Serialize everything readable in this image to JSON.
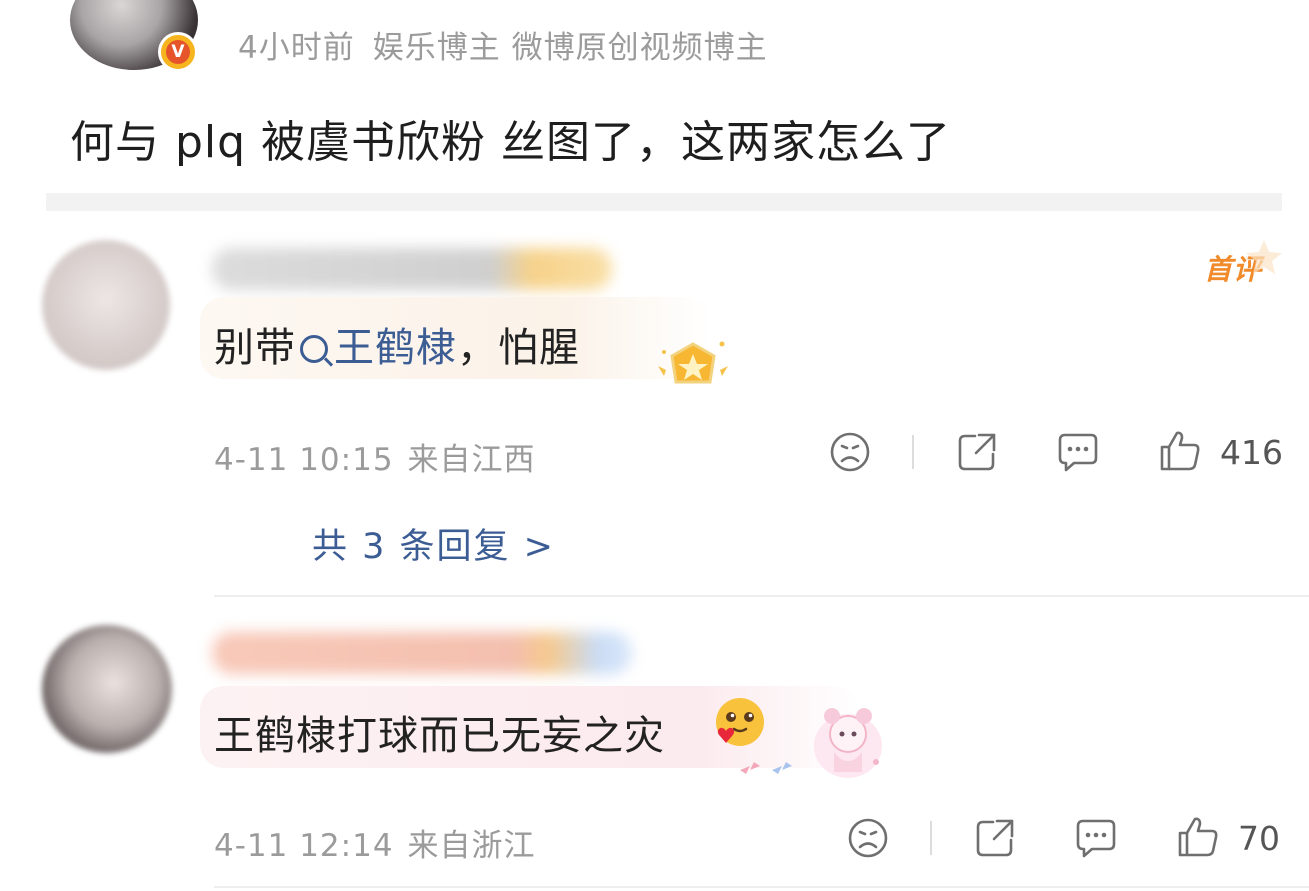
{
  "post": {
    "time": "4小时前",
    "tags": "娱乐博主 微博原创视频博主",
    "verified_mark": "V",
    "text": "何与 plq 被虞书欣粉 丝图了，这两家怎么了"
  },
  "comments": [
    {
      "first_tag": "首评",
      "text_prefix": "别带",
      "link": "王鹤棣",
      "text_suffix": "，怕腥",
      "date": "4-11 10:15",
      "location": "来自江西",
      "likes": "416",
      "replies": "共 3 条回复 >"
    },
    {
      "text": "王鹤棣打球而已无妄之灾",
      "date": "4-11 12:14",
      "location": "来自浙江",
      "likes": "70"
    }
  ],
  "icons": {
    "reaction": "sad-face-icon",
    "share": "share-icon",
    "comment": "comment-icon",
    "like": "thumbs-up-icon"
  },
  "colors": {
    "link": "#3c5c94",
    "meta": "#9b9b9b",
    "first_tag": "#f08a2a"
  }
}
